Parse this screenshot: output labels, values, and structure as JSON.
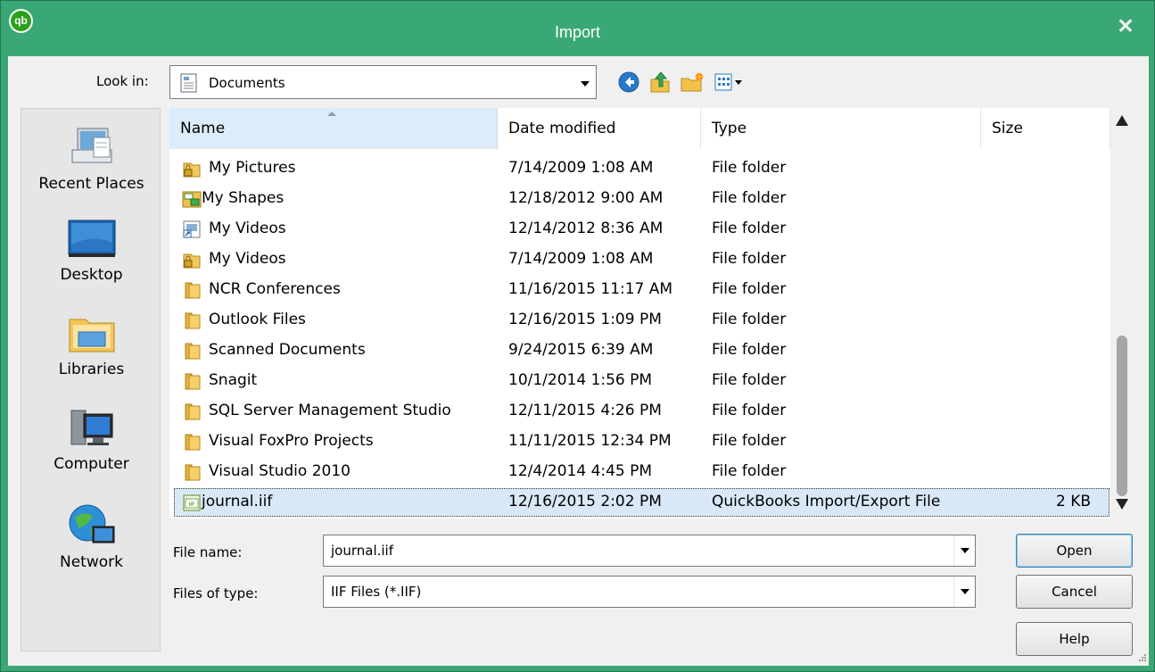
{
  "window": {
    "title": "Import",
    "app_icon": "qb",
    "close_glyph": "✕"
  },
  "toolbar": {
    "look_in_label": "Look in:",
    "look_in_value": "Documents",
    "back_icon": "back-arrow-icon",
    "up_icon": "up-folder-icon",
    "new_folder_icon": "new-folder-icon",
    "views_icon": "view-menu-icon"
  },
  "places": [
    {
      "label": "Recent Places",
      "icon": "recent-places-icon"
    },
    {
      "label": "Desktop",
      "icon": "desktop-icon"
    },
    {
      "label": "Libraries",
      "icon": "libraries-icon"
    },
    {
      "label": "Computer",
      "icon": "computer-icon"
    },
    {
      "label": "Network",
      "icon": "network-icon"
    }
  ],
  "columns": {
    "name": "Name",
    "date": "Date modified",
    "type": "Type",
    "size": "Size"
  },
  "rows": [
    {
      "name": "My Pictures",
      "date": "7/14/2009 1:08 AM",
      "type": "File folder",
      "size": "",
      "icon": "locked-folder-icon"
    },
    {
      "name": "My Shapes",
      "date": "12/18/2012 9:00 AM",
      "type": "File folder",
      "size": "",
      "icon": "shapes-folder-icon"
    },
    {
      "name": "My Videos",
      "date": "12/14/2012 8:36 AM",
      "type": "File folder",
      "size": "",
      "icon": "shortcut-icon"
    },
    {
      "name": "My Videos",
      "date": "7/14/2009 1:08 AM",
      "type": "File folder",
      "size": "",
      "icon": "locked-folder-icon"
    },
    {
      "name": "NCR Conferences",
      "date": "11/16/2015 11:17 AM",
      "type": "File folder",
      "size": "",
      "icon": "folder-icon"
    },
    {
      "name": "Outlook Files",
      "date": "12/16/2015 1:09 PM",
      "type": "File folder",
      "size": "",
      "icon": "folder-icon"
    },
    {
      "name": "Scanned Documents",
      "date": "9/24/2015 6:39 AM",
      "type": "File folder",
      "size": "",
      "icon": "folder-icon"
    },
    {
      "name": "Snagit",
      "date": "10/1/2014 1:56 PM",
      "type": "File folder",
      "size": "",
      "icon": "folder-icon"
    },
    {
      "name": "SQL Server Management Studio",
      "date": "12/11/2015 4:26 PM",
      "type": "File folder",
      "size": "",
      "icon": "folder-icon"
    },
    {
      "name": "Visual FoxPro Projects",
      "date": "11/11/2015 12:34 PM",
      "type": "File folder",
      "size": "",
      "icon": "folder-icon"
    },
    {
      "name": "Visual Studio 2010",
      "date": "12/4/2014 4:45 PM",
      "type": "File folder",
      "size": "",
      "icon": "folder-icon"
    },
    {
      "name": "journal.iif",
      "date": "12/16/2015 2:02 PM",
      "type": "QuickBooks Import/Export File",
      "size": "2 KB",
      "icon": "iif-file-icon",
      "selected": true
    }
  ],
  "form": {
    "file_name_label": "File name:",
    "file_name_value": "journal.iif",
    "file_type_label": "Files of type:",
    "file_type_value": "IIF Files (*.IIF)"
  },
  "buttons": {
    "open": "Open",
    "cancel": "Cancel",
    "help": "Help"
  },
  "colors": {
    "titlebar": "#3aa876",
    "selection": "#d8e8f7",
    "header_sorted": "#dcecf8"
  }
}
